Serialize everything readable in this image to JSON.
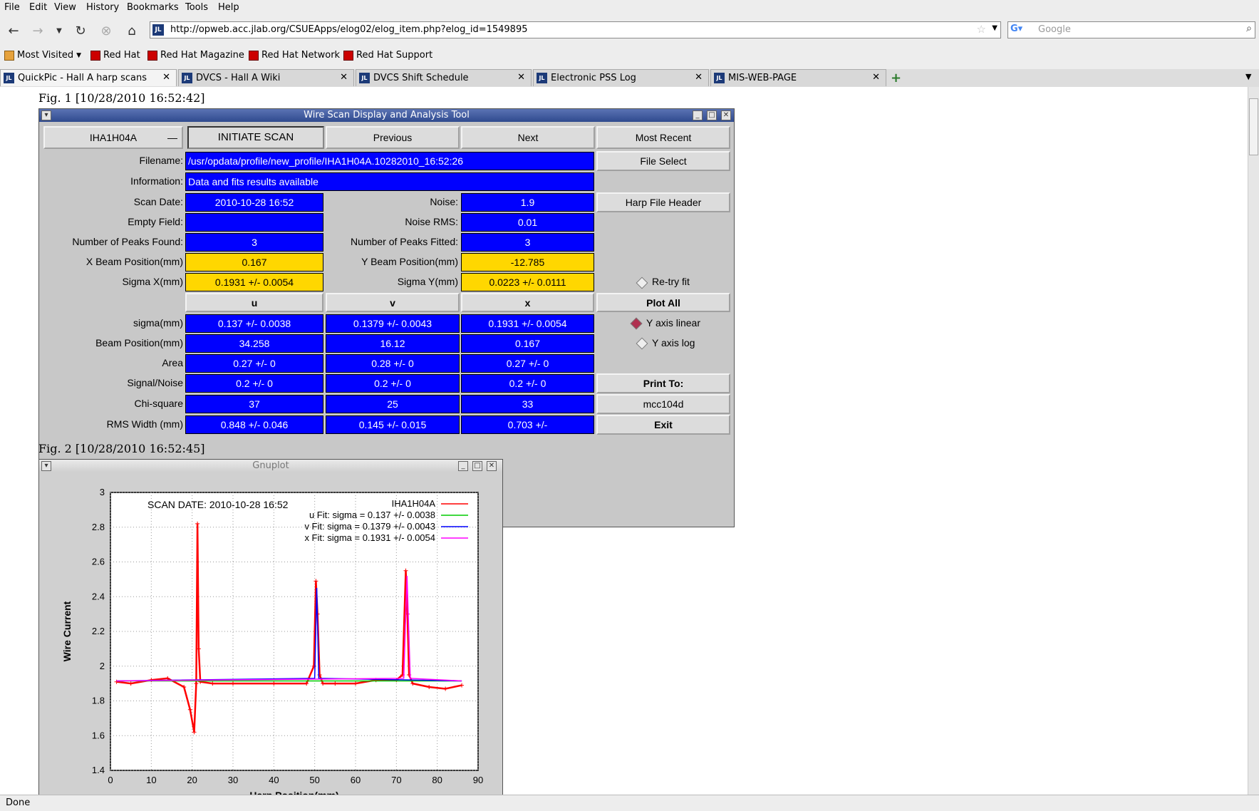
{
  "menubar": [
    "File",
    "Edit",
    "View",
    "History",
    "Bookmarks",
    "Tools",
    "Help"
  ],
  "url": "http://opweb.acc.jlab.org/CSUEApps/elog02/elog_item.php?elog_id=1549895",
  "search_placeholder": "Google",
  "bookmarks": [
    "Most Visited",
    "Red Hat",
    "Red Hat Magazine",
    "Red Hat Network",
    "Red Hat Support"
  ],
  "tabs": [
    "QuickPic - Hall A harp scans",
    "DVCS - Hall A Wiki",
    "DVCS Shift Schedule",
    "Electronic PSS Log",
    "MIS-WEB-PAGE"
  ],
  "fig1_caption": "Fig. 1 [10/28/2010 16:52:42]",
  "fig2_caption": "Fig. 2 [10/28/2010 16:52:45]",
  "status": "Done",
  "tool": {
    "title": "Wire Scan Display and Analysis Tool",
    "harp_select": "IHA1H04A",
    "initiate": "INITIATE SCAN",
    "previous": "Previous",
    "next": "Next",
    "most_recent": "Most Recent",
    "filename_label": "Filename:",
    "filename": "/usr/opdata/profile/new_profile/IHA1H04A.10282010_16:52:26",
    "file_select": "File Select",
    "info_label": "Information:",
    "info": "Data and fits results available",
    "scan_date_label": "Scan Date:",
    "scan_date": "2010-10-28   16:52",
    "noise_label": "Noise:",
    "noise": "1.9",
    "harp_header": "Harp File Header",
    "empty_field_label": "Empty Field:",
    "empty_field": "",
    "noise_rms_label": "Noise RMS:",
    "noise_rms": "0.01",
    "peaks_found_label": "Number of Peaks Found:",
    "peaks_found": "3",
    "peaks_fitted_label": "Number of Peaks Fitted:",
    "peaks_fitted": "3",
    "xpos_label": "X Beam Position(mm)",
    "xpos": "0.167",
    "ypos_label": "Y Beam Position(mm)",
    "ypos": "-12.785",
    "sigx_label": "Sigma X(mm)",
    "sigx": "0.1931 +/- 0.0054",
    "sigy_label": "Sigma Y(mm)",
    "sigy": "0.0223 +/- 0.0111",
    "retry": "Re-try fit",
    "col_u": "u",
    "col_v": "v",
    "col_x": "x",
    "plot_all": "Plot All",
    "ylinear": "Y axis linear",
    "ylog": "Y axis log",
    "print_to": "Print To:",
    "printer": "mcc104d",
    "exit": "Exit",
    "rows": [
      {
        "label": "sigma(mm)",
        "u": "0.137 +/- 0.0038",
        "v": "0.1379 +/- 0.0043",
        "x": "0.1931 +/- 0.0054"
      },
      {
        "label": "Beam Position(mm)",
        "u": "34.258",
        "v": "16.12",
        "x": "0.167"
      },
      {
        "label": "Area",
        "u": "0.27 +/- 0",
        "v": "0.28 +/- 0",
        "x": "0.27 +/- 0"
      },
      {
        "label": "Signal/Noise",
        "u": "0.2 +/- 0",
        "v": "0.2 +/- 0",
        "x": "0.2 +/- 0"
      },
      {
        "label": "Chi-square",
        "u": "37",
        "v": "25",
        "x": "33"
      },
      {
        "label": "RMS Width (mm)",
        "u": "0.848 +/- 0.046",
        "v": "0.145 +/- 0.015",
        "x": "0.703 +/-"
      }
    ]
  },
  "gnuplot_title": "Gnuplot",
  "chart_data": {
    "type": "line",
    "title": "SCAN DATE: 2010-10-28   16:52",
    "xlabel": "Harp Position(mm)",
    "ylabel": "Wire Current",
    "xlim": [
      0,
      90
    ],
    "ylim": [
      1.4,
      3
    ],
    "x_ticks": [
      "0",
      "10",
      "20",
      "30",
      "40",
      "50",
      "60",
      "70",
      "80",
      "90"
    ],
    "y_ticks": [
      "1.4",
      "1.6",
      "1.8",
      "2",
      "2.2",
      "2.4",
      "2.6",
      "2.8",
      "3"
    ],
    "grid": true,
    "legend_position": "top-right",
    "series": [
      {
        "name": "IHA1H04A",
        "color": "#ff0000",
        "x": [
          1.5,
          5,
          10,
          14,
          18,
          19.5,
          20.5,
          21,
          21.3,
          21.6,
          22,
          25,
          30,
          40,
          48,
          49.8,
          50.3,
          50.7,
          51.2,
          52,
          55,
          60,
          65,
          70,
          71.5,
          72.3,
          72.7,
          73.1,
          74,
          78,
          82,
          86
        ],
        "y": [
          1.91,
          1.9,
          1.92,
          1.93,
          1.88,
          1.75,
          1.62,
          1.9,
          2.82,
          2.1,
          1.91,
          1.9,
          1.9,
          1.9,
          1.9,
          2.0,
          2.49,
          2.3,
          1.95,
          1.9,
          1.9,
          1.9,
          1.92,
          1.92,
          1.95,
          2.55,
          2.3,
          1.95,
          1.9,
          1.88,
          1.87,
          1.89
        ]
      },
      {
        "name": "u  Fit: sigma = 0.137 +/- 0.0038",
        "color": "#00cc00",
        "x": [
          1.5,
          20.5,
          21.3,
          22,
          50.3,
          72.5,
          86
        ],
        "y": [
          1.915,
          1.915,
          1.915,
          1.915,
          1.915,
          1.915,
          1.915
        ]
      },
      {
        "name": "v  Fit: sigma = 0.1379 +/- 0.0043",
        "color": "#0000ff",
        "x": [
          1.5,
          50,
          50.5,
          51,
          86
        ],
        "y": [
          1.915,
          1.93,
          2.45,
          1.93,
          1.915
        ]
      },
      {
        "name": "x  Fit: sigma = 0.1931 +/- 0.0054",
        "color": "#ff00ff",
        "x": [
          1.5,
          71.8,
          72.6,
          73.4,
          86
        ],
        "y": [
          1.915,
          1.93,
          2.52,
          1.93,
          1.915
        ]
      }
    ]
  }
}
